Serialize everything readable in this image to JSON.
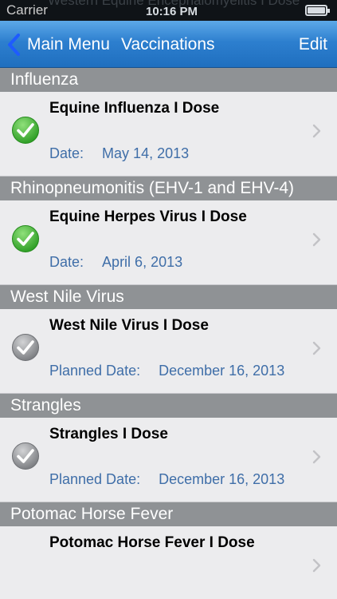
{
  "status_bar": {
    "carrier": "Carrier",
    "background_text": "Western Equine Encephalomyelitis I Dose",
    "time": "10:16 PM"
  },
  "nav": {
    "back_label": "Main Menu",
    "title": "Vaccinations",
    "edit_label": "Edit"
  },
  "sections": [
    {
      "header": "Influenza",
      "row": {
        "title": "Equine Influenza I Dose",
        "status_icon": "check-green",
        "date_label": "Date:",
        "date_value": "May 14, 2013"
      }
    },
    {
      "header": "Rhinopneumonitis (EHV-1 and EHV-4)",
      "row": {
        "title": "Equine Herpes Virus I Dose",
        "status_icon": "check-green",
        "date_label": "Date:",
        "date_value": "April 6, 2013"
      }
    },
    {
      "header": "West Nile Virus",
      "row": {
        "title": "West Nile Virus I Dose",
        "status_icon": "check-gray",
        "date_label": "Planned Date:",
        "date_value": "December 16, 2013"
      }
    },
    {
      "header": "Strangles",
      "row": {
        "title": "Strangles I Dose",
        "status_icon": "check-gray",
        "date_label": "Planned Date:",
        "date_value": "December 16, 2013"
      }
    },
    {
      "header": "Potomac Horse Fever",
      "row": {
        "title": "Potomac Horse Fever I Dose",
        "status_icon": "",
        "date_label": "",
        "date_value": ""
      }
    }
  ],
  "colors": {
    "nav_top": "#5da9e8",
    "nav_bottom": "#1f6fbf",
    "section_header": "#8f9295",
    "date_text": "#3f6ea8",
    "check_green": "#3fb833",
    "check_gray": "#8e9093"
  }
}
